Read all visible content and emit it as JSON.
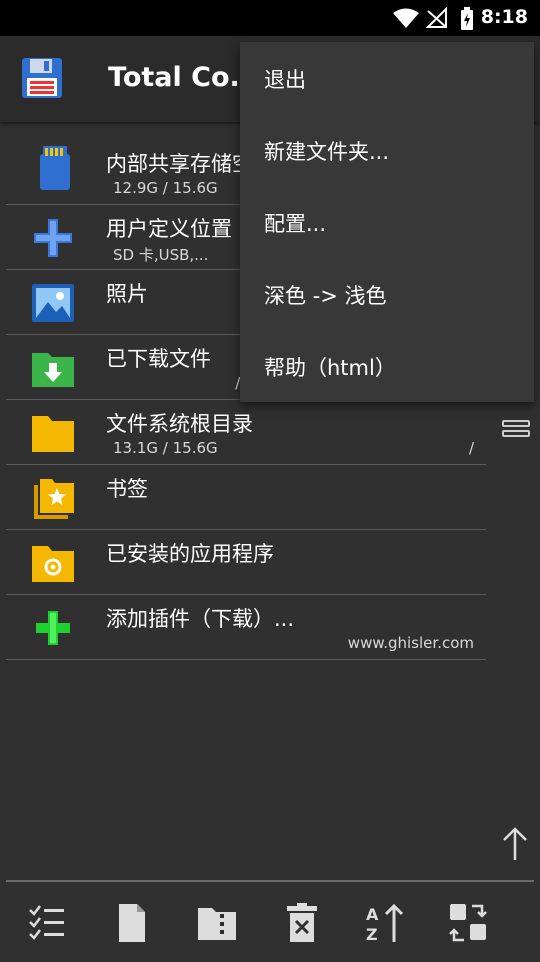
{
  "status_bar": {
    "time": "8:18"
  },
  "app_bar": {
    "title": "Total Co..."
  },
  "list": {
    "items": [
      {
        "label": "内部共享存储空间",
        "sub": "12.9G / 15.6G",
        "right": "",
        "icon": "sd-card-icon"
      },
      {
        "label": "用户定义位置",
        "sub": "SD 卡,USB,...",
        "right": "",
        "icon": "plus-icon"
      },
      {
        "label": "照片",
        "sub": "",
        "right": "",
        "icon": "photo-icon"
      },
      {
        "label": "已下载文件",
        "sub": "",
        "right": "/st",
        "icon": "download-folder-icon"
      },
      {
        "label": "文件系统根目录",
        "sub": "13.1G / 15.6G",
        "right": "/",
        "icon": "folder-icon"
      },
      {
        "label": "书签",
        "sub": "",
        "right": "",
        "icon": "bookmark-star-icon"
      },
      {
        "label": "已安装的应用程序",
        "sub": "",
        "right": "",
        "icon": "apps-folder-icon"
      },
      {
        "label": "添加插件（下载）...",
        "sub": "",
        "right": "www.ghisler.com",
        "icon": "green-plus-icon"
      }
    ]
  },
  "menu": {
    "items": [
      {
        "label": "退出"
      },
      {
        "label": "新建文件夹..."
      },
      {
        "label": "配置..."
      },
      {
        "label": "深色 -> 浅色"
      },
      {
        "label": "帮助（html）"
      }
    ]
  },
  "toolbar": {
    "icons": [
      "select-list-icon",
      "file-icon",
      "zip-folder-icon",
      "delete-icon",
      "sort-az-icon",
      "swap-icon"
    ]
  }
}
